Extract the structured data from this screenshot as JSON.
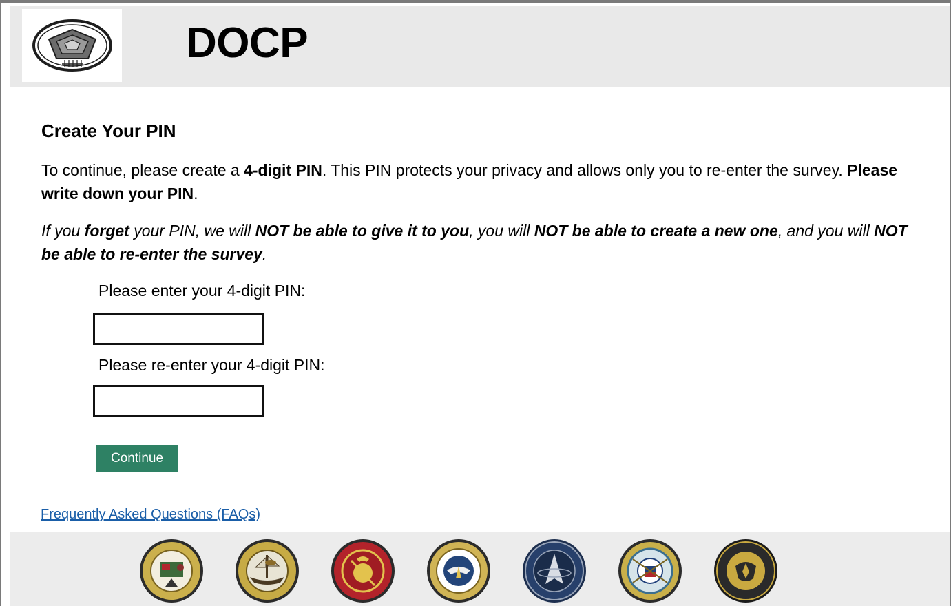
{
  "header": {
    "logo_icon": "pentagon-logo-icon",
    "title": "DOCP"
  },
  "main": {
    "heading": "Create Your PIN",
    "intro": {
      "part1": "To continue, please create a ",
      "bold1": "4-digit PIN",
      "part2": ".  This PIN protects your privacy and allows only you to re-enter the survey.  ",
      "bold2": "Please write down your PIN",
      "part3": "."
    },
    "warning": {
      "t1": "If you ",
      "b1": "forget",
      "t2": " your PIN, we will ",
      "b2": "NOT be able to give it to you",
      "t3": ", you will ",
      "b3": "NOT be able to create a new one",
      "t4": ", and you will ",
      "b4": "NOT be able to re-enter the survey",
      "t5": "."
    },
    "pin_label": "Please enter your 4-digit PIN:",
    "pin_value": "",
    "pin_confirm_label": "Please re-enter your 4-digit PIN:",
    "pin_confirm_value": "",
    "continue_label": "Continue",
    "faq_link": "Frequently Asked Questions (FAQs)"
  },
  "footer": {
    "seals": [
      {
        "name": "army-seal-icon",
        "color": "#c9b04a"
      },
      {
        "name": "navy-seal-icon",
        "color": "#c9b04a"
      },
      {
        "name": "marine-corps-seal-icon",
        "color": "#b0242b"
      },
      {
        "name": "air-force-seal-icon",
        "color": "#23457a"
      },
      {
        "name": "space-force-seal-icon",
        "color": "#1d2f4f"
      },
      {
        "name": "coast-guard-seal-icon",
        "color": "#c9b04a"
      },
      {
        "name": "national-guard-seal-icon",
        "color": "#2a2a2a"
      }
    ]
  },
  "colors": {
    "header_bg": "#e9e9e9",
    "footer_bg": "#ececec",
    "button_bg": "#2e8164",
    "link": "#1a5ea8"
  }
}
